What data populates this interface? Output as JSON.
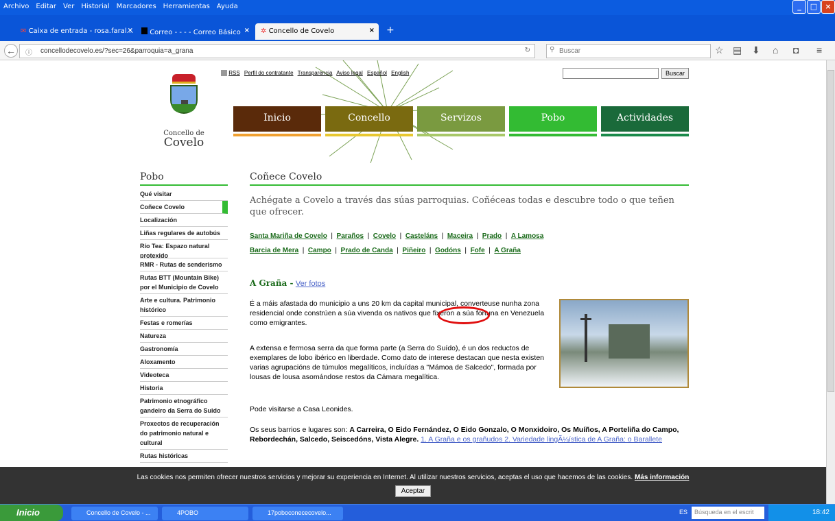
{
  "menubar": {
    "items": [
      "Archivo",
      "Editar",
      "Ver",
      "Historial",
      "Marcadores",
      "Herramientas",
      "Ayuda"
    ]
  },
  "tabs": [
    {
      "label": "Caixa de entrada - rosa.faral...",
      "close": "×"
    },
    {
      "label": "Correo - - - - Correo Básico",
      "close": "×"
    },
    {
      "label": "Concello de Covelo",
      "close": "×"
    }
  ],
  "newtab": "+",
  "url": "concellodecovelo.es/?sec=26&parroquia=a_grana",
  "search_placeholder": "Buscar",
  "site": {
    "toplinks": [
      "RSS",
      "Perfil do contratante",
      "Transparencia",
      "Aviso legal",
      "Español",
      "English"
    ],
    "search_button": "Buscar",
    "logo_line1": "Concello de",
    "logo_line2": "Covelo",
    "mainmenu": [
      {
        "label": "Inicio",
        "color": "#5a2a0a",
        "under": "#f0a030"
      },
      {
        "label": "Concello",
        "color": "#7a6a10",
        "under": "#e8c830"
      },
      {
        "label": "Servizos",
        "color": "#7a9a40",
        "under": "#a8c868"
      },
      {
        "label": "Pobo",
        "color": "#33bb33",
        "under": "#33bb33"
      },
      {
        "label": "Actividades",
        "color": "#1a6a3a",
        "under": "#1a8a4a"
      }
    ],
    "sidebar_title": "Pobo",
    "sidebar_items": [
      "Qué visitar",
      "Coñece Covelo",
      "Localización",
      "Liñas regulares de autobús",
      "Río Tea: Espazo natural protexido",
      "RMR - Rutas de senderismo",
      "Rutas BTT (Mountain Bike) por el Municipio de Covelo",
      "Arte e cultura. Patrimonio histórico",
      "Festas e romerías",
      "Natureza",
      "Gastronomía",
      "Aloxamento",
      "Videoteca",
      "Historia",
      "Patrimonio etnográfico gandeiro da Serra do Suido",
      "Proxectos de recuperación do patrimonio natural e cultural",
      "Rutas históricas"
    ],
    "content_title": "Coñece Covelo",
    "intro": "Achégate a Covelo a través das súas parroquias. Coñéceas todas e descubre todo o que teñen que ofrecer.",
    "parroquias_row1": [
      "Santa Mariña de Covelo",
      "Paraños",
      "Covelo",
      "Casteláns",
      "Maceira",
      "Prado",
      "A Lamosa"
    ],
    "parroquias_row2": [
      "Barcia de Mera",
      "Campo",
      "Prado de Canda",
      "Piñeiro",
      "Godóns",
      "Fofe",
      "A Graña"
    ],
    "sep": "|",
    "section_title": "A Graña -",
    "ver_fotos": "Ver fotos",
    "p1": "É a máis afastada do municipio a uns 20 km da capital municipal, converteuse nunha zona residencial onde constrúen a súa vivenda os nativos que fixeron a súa fortuna en Venezuela como emigrantes.",
    "p2": "A extensa e fermosa serra da que forma parte (a Serra do Suído), é un dos reductos de exemplares de lobo ibérico en liberdade. Como dato de interese destacan que nesta existen varias agrupacións de túmulos megalíticos, incluídas a \"Mámoa de Salcedo\", formada por lousas de lousa asomándose restos da Cámara megalítica.",
    "p3": "Pode visitarse a Casa Leonides.",
    "p4_start": "Os seus barrios e lugares son:",
    "p4_bold": "A Carreira, O Eido Fernández, O Eido Gonzalo, O Monxidoiro, Os Muíños, A Porteliña do Campo, Rebordechán, Salcedo, Seiscedóns, Vista Alegre.",
    "p4_links": "1. A Graña e os grañudos 2. Variedade lingÃ¼ística de A Graña: o Barallete"
  },
  "cookie": {
    "text": "Las cookies nos permiten ofrecer nuestros servicios y mejorar su experiencia en Internet. Al utilizar nuestros servicios, aceptas el uso que hacemos de las cookies.",
    "more": "Más información",
    "accept": "Aceptar"
  },
  "taskbar": {
    "start": "Inicio",
    "items": [
      "Concello de Covelo - ...",
      "4POBO",
      "17poboconececovelo..."
    ],
    "lang": "ES",
    "search": "Búsqueda en el escrit",
    "time": "18:42"
  }
}
